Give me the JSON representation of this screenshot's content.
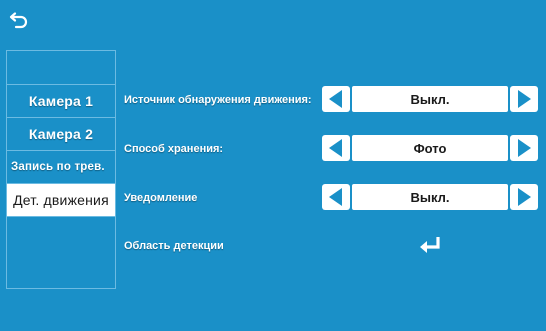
{
  "sidebar": {
    "items": [
      {
        "label": ""
      },
      {
        "label": "Камера 1"
      },
      {
        "label": "Камера 2"
      },
      {
        "label": "Запись по трев."
      },
      {
        "label": "Дет. движения"
      },
      {
        "label": ""
      }
    ],
    "active_index": 4
  },
  "settings": {
    "motion_source": {
      "label": "Источник обнаружения движения:",
      "value": "Выкл."
    },
    "storage_method": {
      "label": "Способ хранения:",
      "value": "Фото"
    },
    "notification": {
      "label": "Уведомление",
      "value": "Выкл."
    },
    "detection_area": {
      "label": "Область детекции"
    }
  },
  "icons": {
    "back": "back-arrow-icon",
    "left": "triangle-left-icon",
    "right": "triangle-right-icon",
    "enter": "enter-return-icon"
  },
  "colors": {
    "background": "#1a90c8",
    "arrow": "#1a90c8",
    "panel": "#ffffff"
  }
}
